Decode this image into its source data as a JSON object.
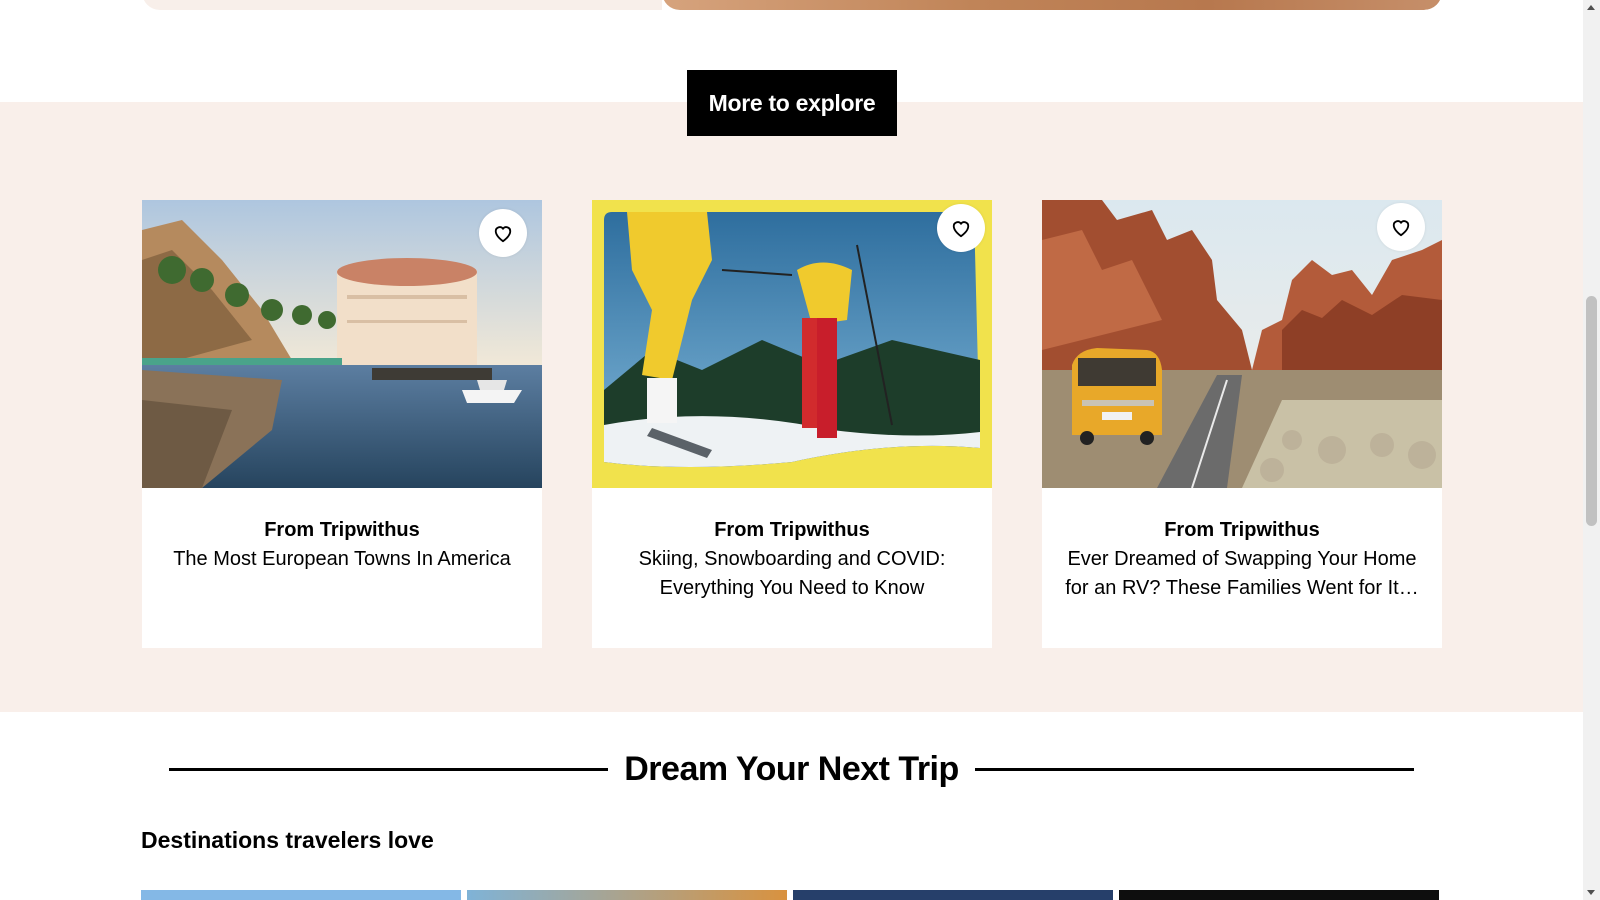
{
  "explore": {
    "tag_label": "More to explore"
  },
  "cards": [
    {
      "source": "From Tripwithus",
      "title": "The Most European Towns In America",
      "image": "catalina-casino-harbor-image"
    },
    {
      "source": "From Tripwithus",
      "title": "Skiing, Snowboarding and COVID: Everything You Need to Know",
      "image": "retro-skiers-image"
    },
    {
      "source": "From Tripwithus",
      "title": "Ever Dreamed of Swapping Your Home for an RV? These Families Went for It…",
      "image": "yellow-van-desert-road-image"
    }
  ],
  "dream": {
    "title": "Dream Your Next Trip",
    "subheading": "Destinations travelers love"
  },
  "colors": {
    "section_bg": "#f9efea",
    "tag_bg": "#000000",
    "tag_text": "#ffffff",
    "card_bg": "#ffffff",
    "ski_frame": "#f2e34d"
  },
  "icons": {
    "save": "heart-outline-icon"
  }
}
